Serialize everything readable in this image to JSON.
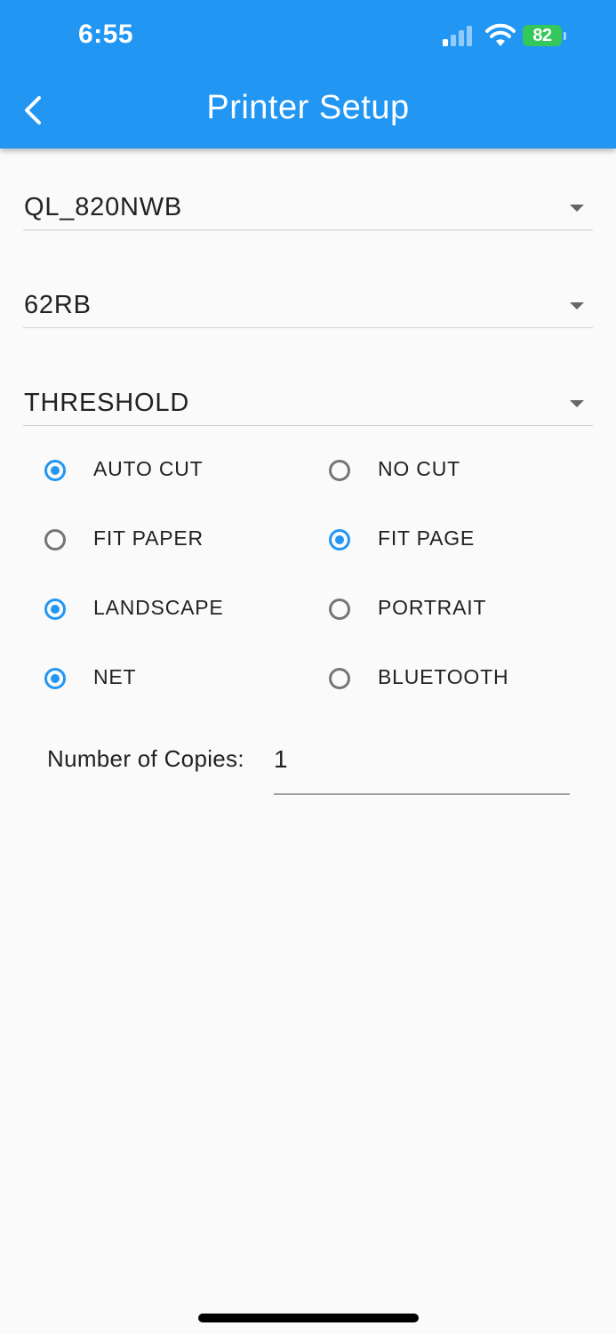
{
  "status_bar": {
    "time": "6:55",
    "battery": "82"
  },
  "header": {
    "title": "Printer Setup",
    "back_icon": "chevron-left-icon",
    "color": "#2196f3"
  },
  "dropdowns": {
    "printer": "QL_820NWB",
    "label": "62RB",
    "mode": "THRESHOLD"
  },
  "options": [
    {
      "left": {
        "label": "AUTO CUT",
        "selected": true
      },
      "right": {
        "label": "NO CUT",
        "selected": false
      }
    },
    {
      "left": {
        "label": "FIT PAPER",
        "selected": false
      },
      "right": {
        "label": "FIT PAGE",
        "selected": true
      }
    },
    {
      "left": {
        "label": "LANDSCAPE",
        "selected": true
      },
      "right": {
        "label": "PORTRAIT",
        "selected": false
      }
    },
    {
      "left": {
        "label": "NET",
        "selected": true
      },
      "right": {
        "label": "BLUETOOTH",
        "selected": false
      }
    }
  ],
  "copies": {
    "label": "Number of Copies:",
    "value": "1"
  }
}
